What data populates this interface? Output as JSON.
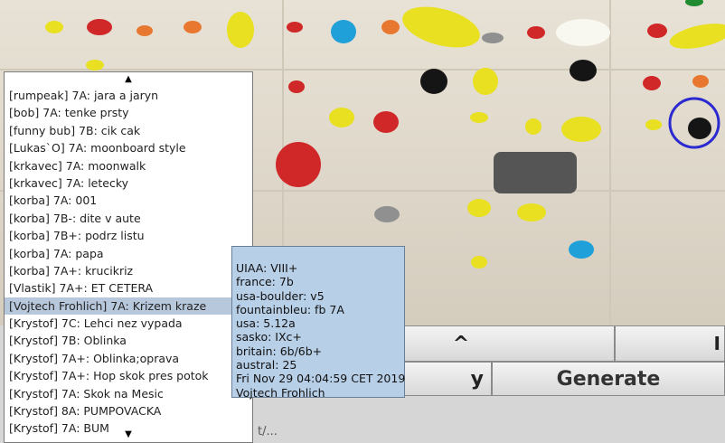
{
  "list": {
    "scroll_up": "▲",
    "scroll_down": "▼",
    "items": [
      "[rumpeak] 7A: jara a jaryn",
      "[bob] 7A: tenke prsty",
      "[funny bub] 7B: cik cak",
      "[Lukas`O] 7A: moonboard style",
      "[krkavec] 7A: moonwalk",
      "[krkavec] 7A: letecky",
      "[korba] 7A: 001",
      "[korba] 7B-: dite v aute",
      "[korba] 7B+: podrz listu",
      "[korba] 7A: papa",
      "[korba] 7A+: krucikriz",
      "[Vlastik] 7A+: ET CETERA",
      "[Vojtech Frohlich] 7A: Krizem kraze",
      "[Krystof] 7C: Lehci nez vypada",
      "[Krystof] 7B: Oblinka",
      "[Krystof] 7A+: Oblinka;oprava",
      "[Krystof] 7A+: Hop skok pres potok",
      "[Krystof] 7A: Skok na Mesic",
      "[Krystof] 8A: PUMPOVACKA",
      "[Krystof] 7A: BUM"
    ],
    "selected_index": 12
  },
  "tooltip": {
    "uiaa": "UIAA: VIII+",
    "france": "france: 7b",
    "usa_boulder": "usa-boulder: v5",
    "fontainbleu": "fountainbleu: fb 7A",
    "usa": "usa: 5.12a",
    "sasko": "sasko: IXc+",
    "britain": "britain: 6b/6b+",
    "austral": "austral: 25",
    "date": "Fri Nov 29 04:04:59 CET 2019",
    "author": "Vojtech Frohlich"
  },
  "buttons": {
    "up": "^",
    "right_top": "I",
    "left": "y",
    "generate": "Generate"
  },
  "status": "t/...",
  "colors": {
    "selection": "#b8c8dc",
    "tooltip_bg": "#b8cfe8",
    "highlight_ring": "#2a2ad0"
  }
}
